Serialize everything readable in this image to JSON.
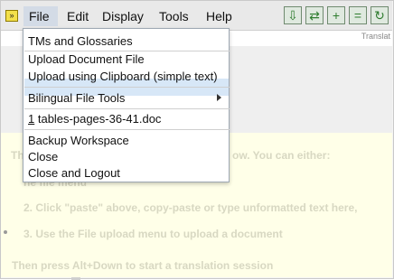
{
  "menubar": {
    "logo": "»",
    "file": "File",
    "edit": "Edit",
    "display": "Display",
    "tools": "Tools",
    "help": "Help"
  },
  "toolbar": {
    "icons": [
      "download-icon",
      "shuffle-icon",
      "add-icon",
      "equal-icon",
      "repeat-icon"
    ]
  },
  "header_right": "Translat",
  "dropdown": {
    "items": [
      {
        "label": "TMs and Glossaries"
      },
      {
        "label": "Upload Document File"
      },
      {
        "label": "Upload using Clipboard (simple text)"
      },
      {
        "label": "Bilingual File Tools"
      },
      {
        "number": "1",
        "label": " tables-pages-36-41.doc"
      },
      {
        "label": "Backup Workspace"
      },
      {
        "label": "Close"
      },
      {
        "label": "Close and Logout"
      }
    ]
  },
  "background_text": {
    "line1_left": "Th",
    "line1_right": "ow. You can either:",
    "line2": "he file menu",
    "line3": "2.    Click \"paste\" above, copy-paste or type unformatted text here,",
    "line4": "3.    Use the File upload menu to upload a document",
    "line5": "Then press Alt+Down to start a translation session"
  }
}
